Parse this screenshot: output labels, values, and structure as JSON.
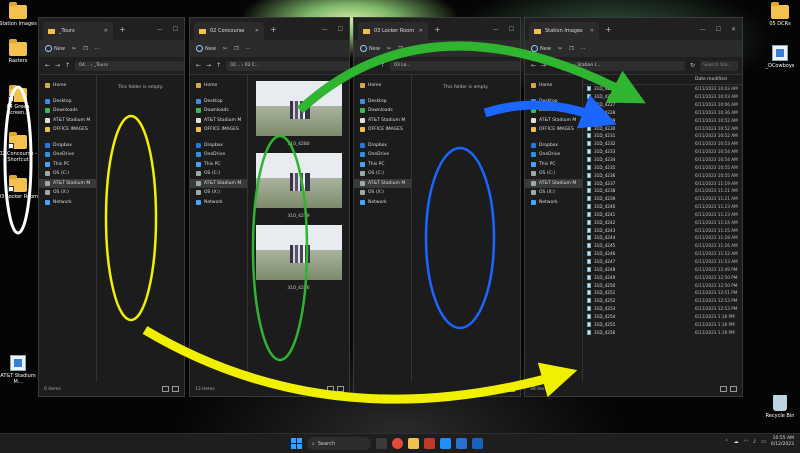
{
  "desktop_left": [
    {
      "label": "Station Images",
      "kind": "folder"
    },
    {
      "label": "Rasters",
      "kind": "folder"
    },
    {
      "label": "04 Green Screen...",
      "kind": "folder-shortcut"
    },
    {
      "label": "02 Concourse - Shortcut",
      "kind": "folder-shortcut"
    },
    {
      "label": "03 Locker Room",
      "kind": "folder-shortcut"
    },
    {
      "label": "AT&T Stadium M...",
      "kind": "app"
    }
  ],
  "desktop_right": [
    {
      "label": "05 DCRs",
      "kind": "folder"
    },
    {
      "label": "_DCowboys",
      "kind": "app"
    },
    {
      "label": "Recycle Bin",
      "kind": "bin"
    }
  ],
  "nav_items": [
    {
      "label": "Home",
      "group": 0
    },
    {
      "label": "Desktop",
      "group": 1
    },
    {
      "label": "Downloads",
      "group": 1
    },
    {
      "label": "AT&T Stadium M",
      "group": 1
    },
    {
      "label": "OFFICE IMAGES",
      "group": 1
    },
    {
      "label": "Dropbox",
      "group": 2
    },
    {
      "label": "OneDrive",
      "group": 2
    },
    {
      "label": "This PC",
      "group": 2
    },
    {
      "label": "OS (C:)",
      "group": 2
    },
    {
      "label": "AT&T Stadium M",
      "group": 2
    },
    {
      "label": "OS (X:)",
      "group": 2
    },
    {
      "label": "Network",
      "group": 2
    }
  ],
  "windows": [
    {
      "tab": "_Tours",
      "path": "04... › _Tours",
      "empty_message": "This folder is empty.",
      "status": "0 items"
    },
    {
      "tab": "02 Concourse",
      "path": "02... › 02 C...",
      "status": "13 items",
      "thumbnails": [
        "310_4280",
        "310_4279",
        "310_4276"
      ]
    },
    {
      "tab": "03 Locker Room",
      "path": "03 Lo...",
      "empty_message": "This folder is empty.",
      "status": ""
    },
    {
      "tab": "Station Images",
      "path": "‹ ... › Station I...",
      "search_placeholder": "Search Sta...",
      "status": "38 items",
      "col_name": "Name",
      "col_date": "Date modified"
    }
  ],
  "toolbar": {
    "new_label": "New"
  },
  "files": [
    {
      "name": "31D_4225",
      "date": "6/11/2023 10:03 AM"
    },
    {
      "name": "31D_4226",
      "date": "6/11/2023 10:03 AM"
    },
    {
      "name": "31D_4227",
      "date": "6/11/2023 10:06 AM"
    },
    {
      "name": "31D_4228",
      "date": "6/11/2023 10:36 AM"
    },
    {
      "name": "31D_4229",
      "date": "6/11/2023 10:52 AM"
    },
    {
      "name": "31D_4230",
      "date": "6/11/2023 10:52 AM"
    },
    {
      "name": "31D_4231",
      "date": "6/11/2023 10:52 AM"
    },
    {
      "name": "31D_4232",
      "date": "6/11/2023 10:53 AM"
    },
    {
      "name": "31D_4233",
      "date": "6/11/2023 10:54 AM"
    },
    {
      "name": "31D_4234",
      "date": "6/11/2023 10:54 AM"
    },
    {
      "name": "31D_4235",
      "date": "6/11/2023 10:55 AM"
    },
    {
      "name": "31D_4236",
      "date": "6/11/2023 10:55 AM"
    },
    {
      "name": "31D_4237",
      "date": "6/11/2023 11:19 AM"
    },
    {
      "name": "31D_4238",
      "date": "6/11/2023 11:21 AM"
    },
    {
      "name": "31D_4239",
      "date": "6/11/2023 11:21 AM"
    },
    {
      "name": "31D_4240",
      "date": "6/11/2023 11:23 AM"
    },
    {
      "name": "31D_4241",
      "date": "6/11/2023 11:23 AM"
    },
    {
      "name": "31D_4242",
      "date": "6/11/2023 11:24 AM"
    },
    {
      "name": "31D_4243",
      "date": "6/11/2023 11:25 AM"
    },
    {
      "name": "31D_4244",
      "date": "6/11/2023 11:28 AM"
    },
    {
      "name": "31D_4245",
      "date": "6/11/2023 11:26 AM"
    },
    {
      "name": "31D_4246",
      "date": "6/11/2023 11:52 AM"
    },
    {
      "name": "31D_4247",
      "date": "6/11/2023 11:53 AM"
    },
    {
      "name": "31D_4248",
      "date": "6/11/2023 12:49 PM"
    },
    {
      "name": "31D_4249",
      "date": "6/11/2023 12:50 PM"
    },
    {
      "name": "31D_4250",
      "date": "6/11/2023 12:50 PM"
    },
    {
      "name": "31D_4251",
      "date": "6/11/2023 12:51 PM"
    },
    {
      "name": "31D_4252",
      "date": "6/11/2023 12:53 PM"
    },
    {
      "name": "31D_4253",
      "date": "6/11/2023 12:53 PM"
    },
    {
      "name": "31D_4254",
      "date": "6/11/2023 1:18 PM"
    },
    {
      "name": "31D_4255",
      "date": "6/11/2023 1:18 PM"
    },
    {
      "name": "31D_4256",
      "date": "6/11/2023 1:19 PM"
    }
  ],
  "taskbar": {
    "search_label": "Search",
    "time": "10:55 AM",
    "date": "6/12/2023"
  },
  "colors": {
    "yellow": "#f0f000",
    "green": "#2fb52f",
    "blue": "#1a66ff",
    "folder": "#f2c14e"
  }
}
